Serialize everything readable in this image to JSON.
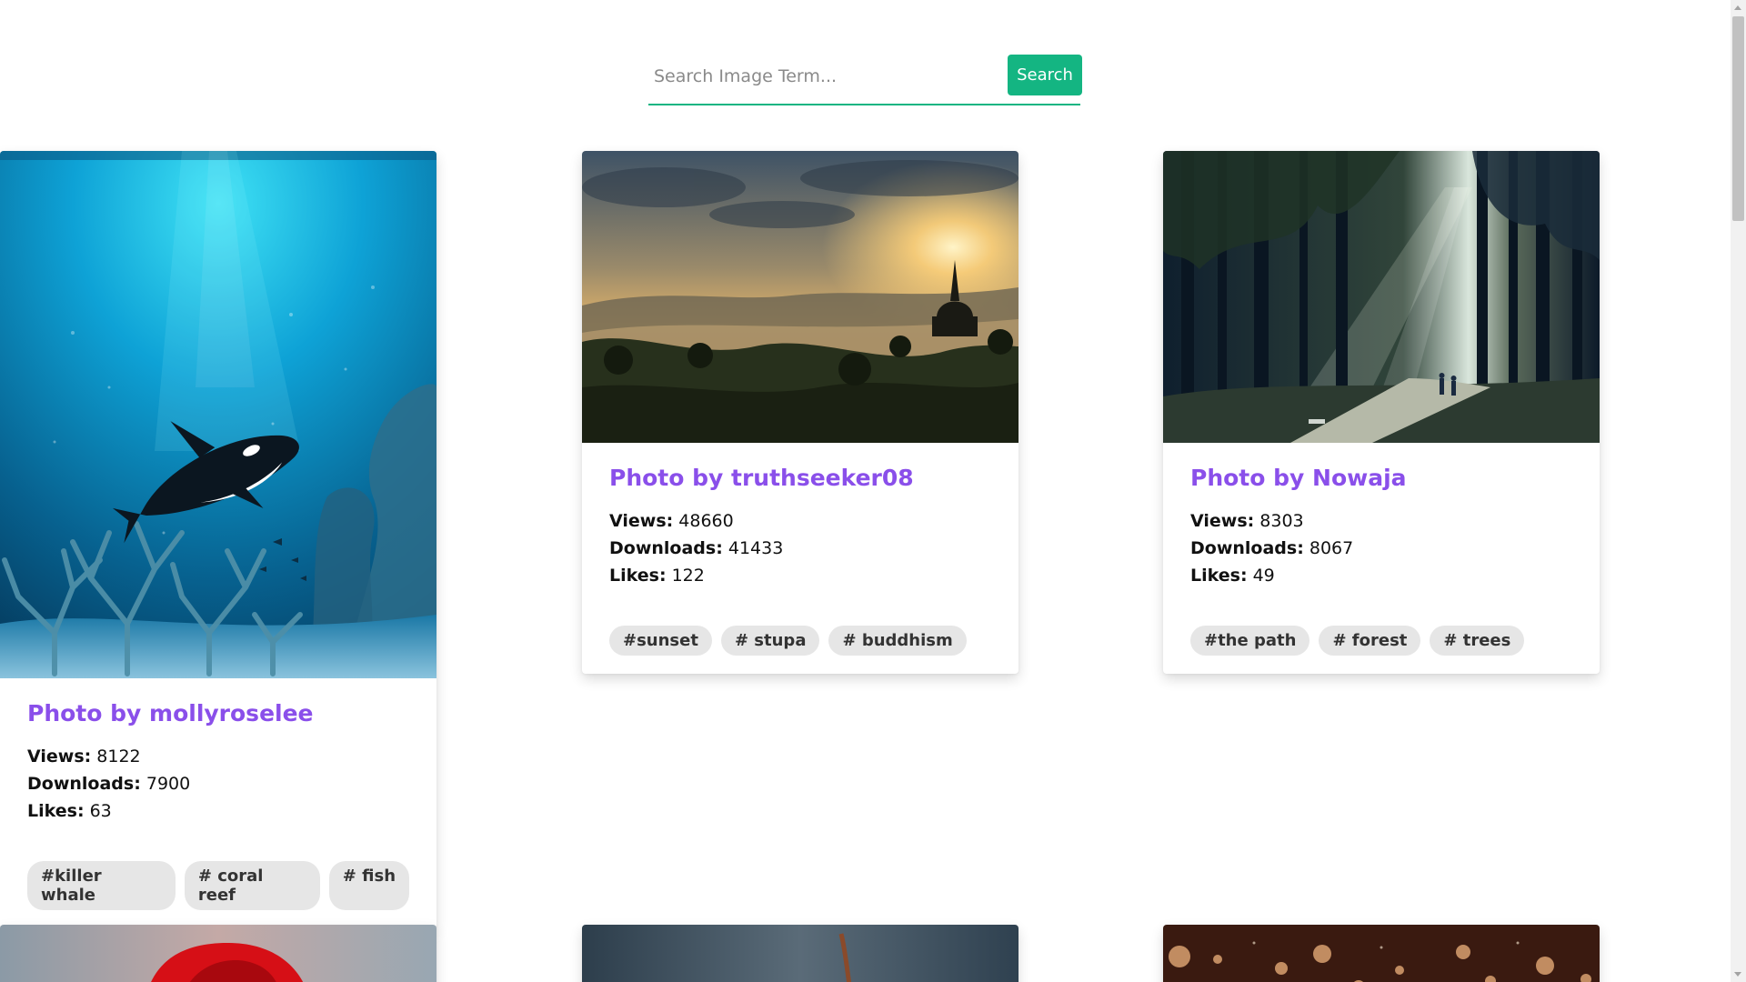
{
  "search": {
    "placeholder": "Search Image Term...",
    "button_label": "Search",
    "accent_color": "#14b582"
  },
  "cards": [
    {
      "title": "Photo by mollyroselee",
      "views_label": "Views:",
      "views": "8122",
      "downloads_label": "Downloads:",
      "downloads": "7900",
      "likes_label": "Likes:",
      "likes": "63",
      "tags": [
        "#killer whale",
        "# coral reef",
        "# fish"
      ]
    },
    {
      "title": "Photo by truthseeker08",
      "views_label": "Views:",
      "views": "48660",
      "downloads_label": "Downloads:",
      "downloads": "41433",
      "likes_label": "Likes:",
      "likes": "122",
      "tags": [
        "#sunset",
        "# stupa",
        "# buddhism"
      ]
    },
    {
      "title": "Photo by Nowaja",
      "views_label": "Views:",
      "views": "8303",
      "downloads_label": "Downloads:",
      "downloads": "8067",
      "likes_label": "Likes:",
      "likes": "49",
      "tags": [
        "#the path",
        "# forest",
        "# trees"
      ]
    }
  ],
  "colors": {
    "title": "#8a4fea",
    "tag_bg": "#e6e6e6"
  }
}
